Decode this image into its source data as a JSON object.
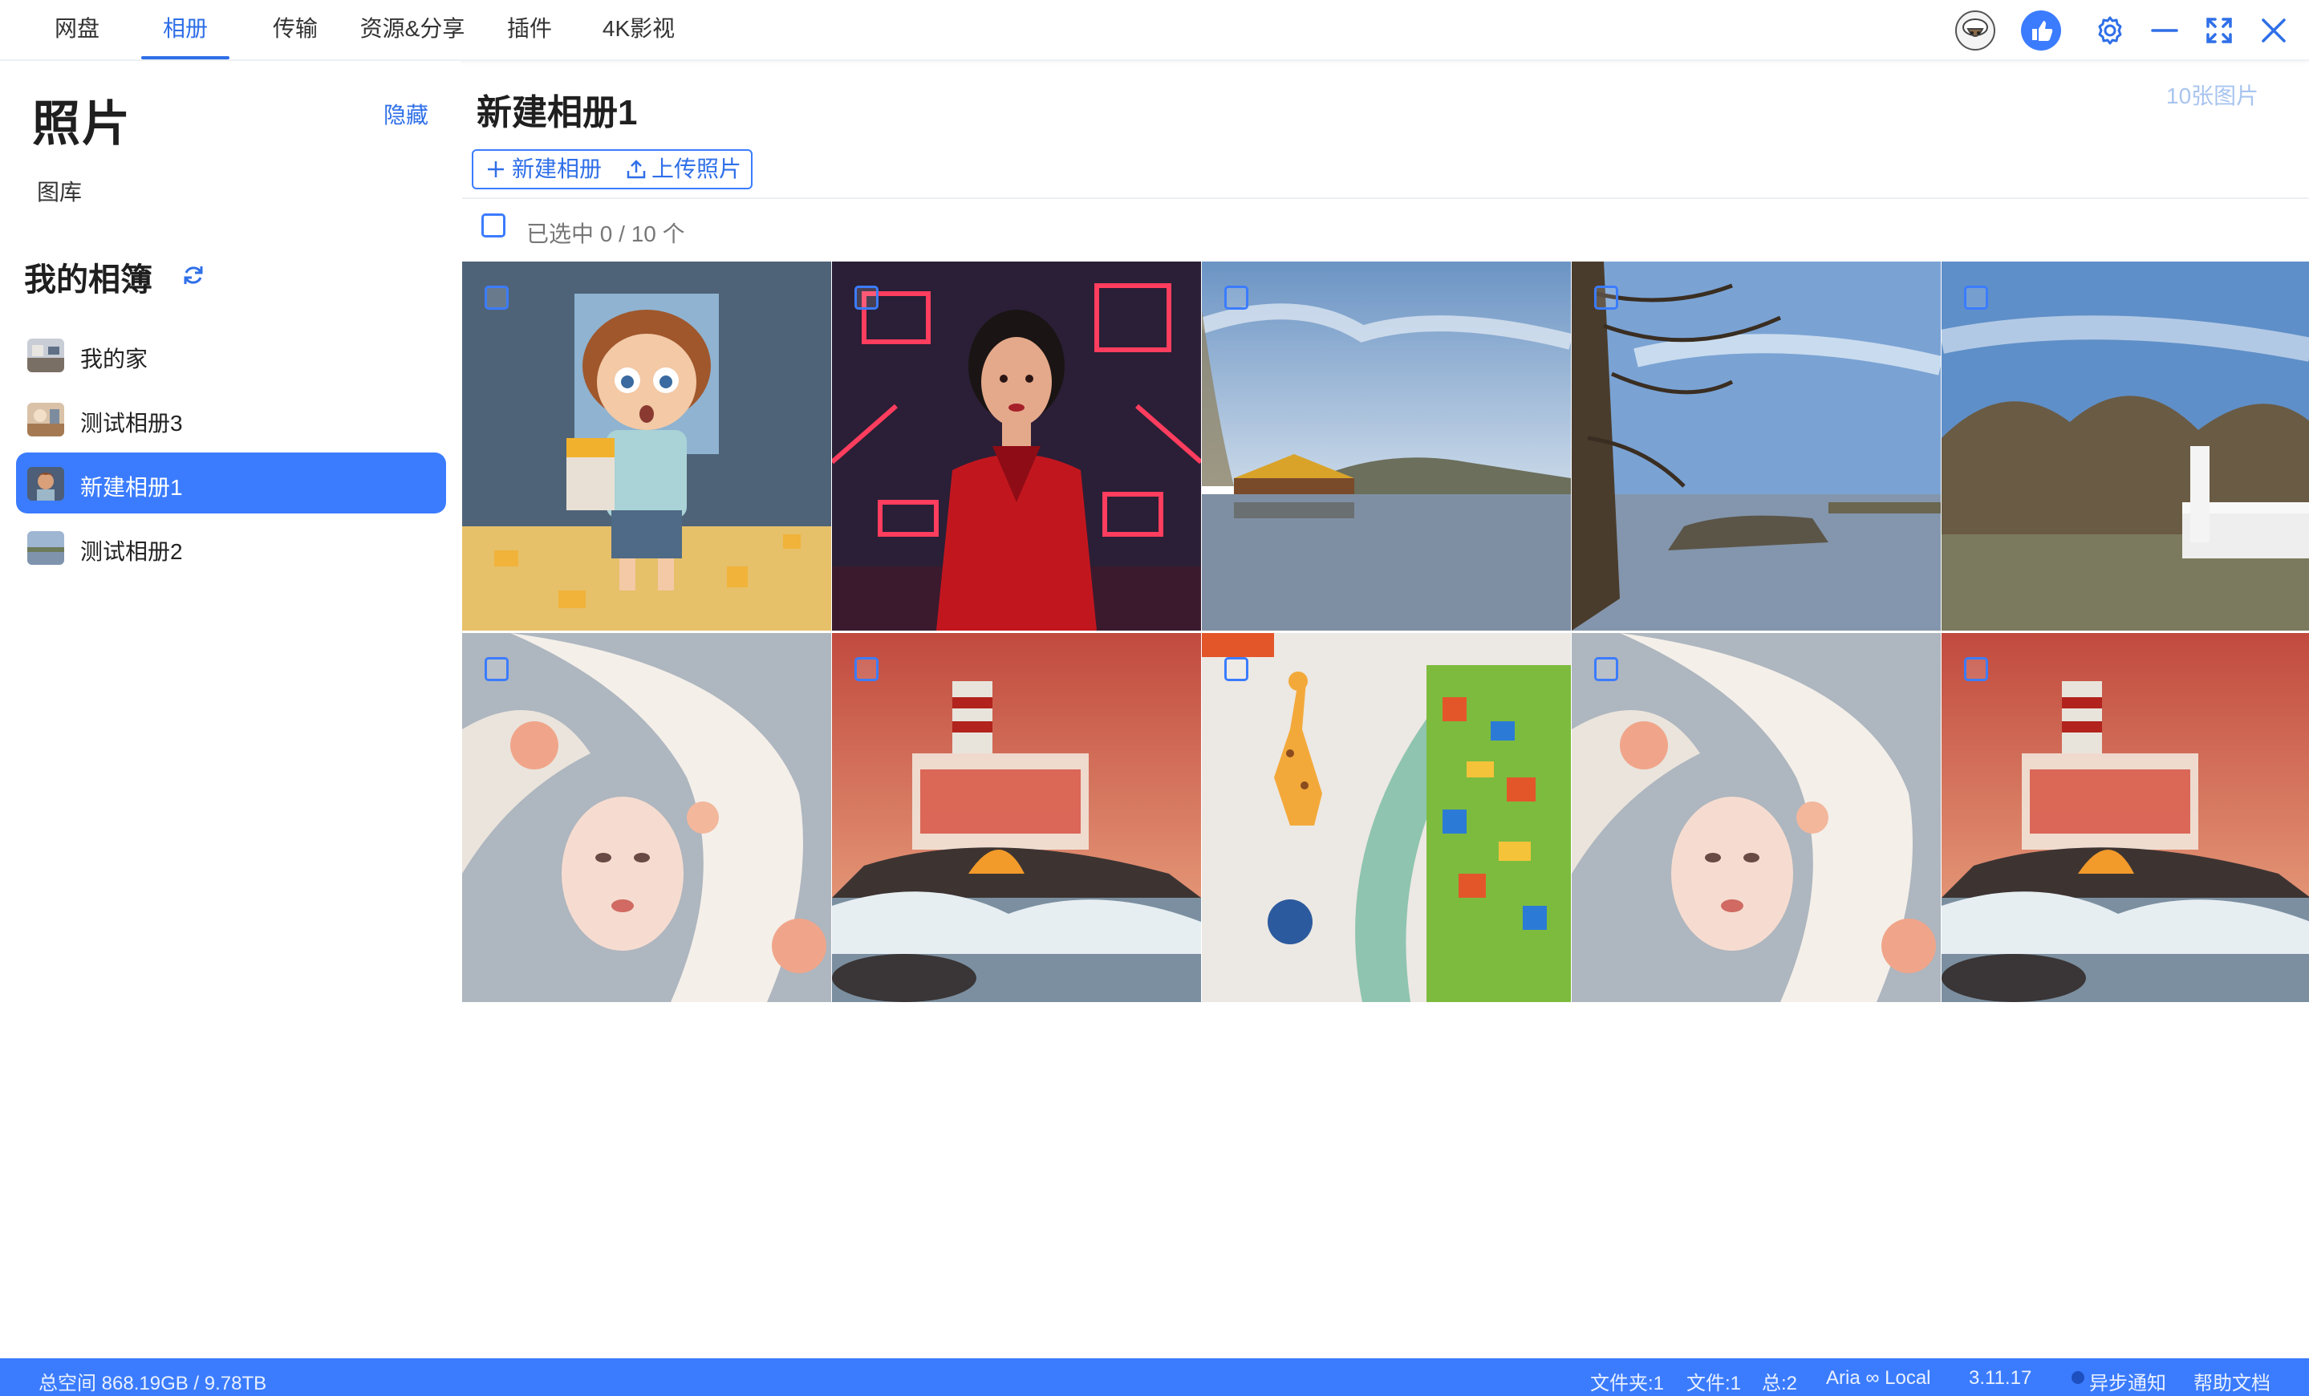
{
  "nav": {
    "tabs": [
      {
        "label": "网盘"
      },
      {
        "label": "相册"
      },
      {
        "label": "传输"
      },
      {
        "label": "资源&分享"
      },
      {
        "label": "插件"
      },
      {
        "label": "4K影视"
      }
    ],
    "active_tab": "相册",
    "icons": [
      "sheep-avatar-icon",
      "thumbs-up-icon",
      "gear-icon",
      "minimize-icon",
      "fullscreen-icon",
      "close-icon"
    ]
  },
  "sidebar": {
    "title": "照片",
    "hide_label": "隐藏",
    "library_label": "图库",
    "albums_heading": "我的相簿",
    "albums": [
      {
        "label": "我的家",
        "selected": false
      },
      {
        "label": "测试相册3",
        "selected": false
      },
      {
        "label": "新建相册1",
        "selected": true
      },
      {
        "label": "测试相册2",
        "selected": false
      }
    ]
  },
  "main": {
    "album_title": "新建相册1",
    "photo_count": "10张图片",
    "new_album_label": "新建相册",
    "upload_label": "上传照片",
    "selected_count": "已选中 0 / 10 个",
    "photos": [
      {
        "subject": "cartoon boy with popcorn"
      },
      {
        "subject": "woman in red neon city"
      },
      {
        "subject": "lake with pavilion"
      },
      {
        "subject": "bare trees by lake"
      },
      {
        "subject": "willow trees and white railing"
      },
      {
        "subject": "pink haired girl illustration"
      },
      {
        "subject": "lighthouse glass house by sea"
      },
      {
        "subject": "toy box with giraffe"
      },
      {
        "subject": "pink haired girl illustration"
      },
      {
        "subject": "lighthouse glass house by sea"
      }
    ]
  },
  "status": {
    "space": "总空间 868.19GB / 9.78TB",
    "folders": "文件夹:1",
    "files": "文件:1",
    "total": "总:2",
    "aria": "Aria ∞ Local",
    "version": "3.11.17",
    "async_notice": "异步通知",
    "help": "帮助文档"
  },
  "colors": {
    "accent": "#3b7cff",
    "accent_text": "#2f6fe8",
    "statusbar": "#3b7cff"
  }
}
